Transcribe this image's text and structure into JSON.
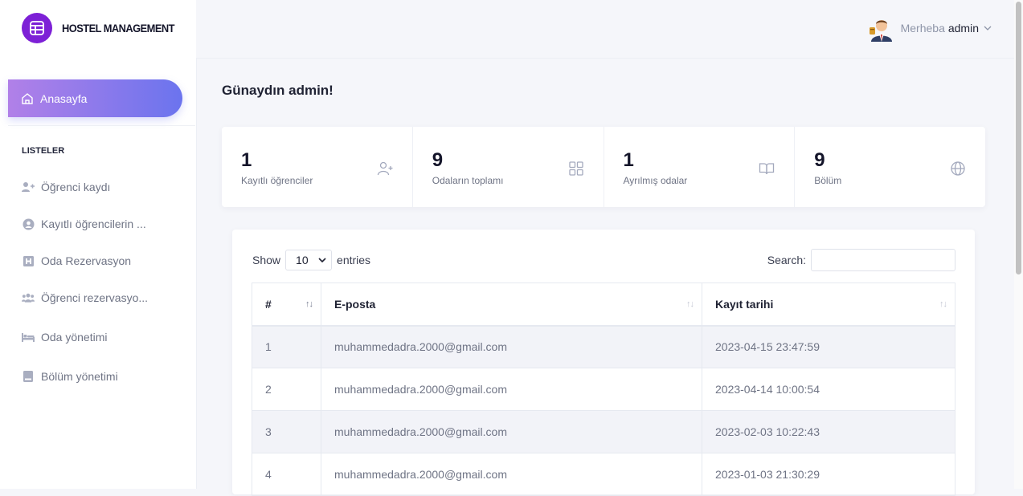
{
  "brand": {
    "name": "HOSTEL MANAGEMENT"
  },
  "sidebar": {
    "active": {
      "label": "Anasayfa",
      "icon": "home-icon"
    },
    "section_title": "LISTELER",
    "items": [
      {
        "label": "Öğrenci kaydı",
        "icon": "user-plus-icon"
      },
      {
        "label": "Kayıtlı öğrencilerin ...",
        "icon": "user-circle-icon"
      },
      {
        "label": "Oda Rezervasyon",
        "icon": "room-icon"
      },
      {
        "label": "Öğrenci rezervasyo...",
        "icon": "users-icon"
      },
      {
        "label": "Oda yönetimi",
        "icon": "bed-icon"
      },
      {
        "label": "Bölüm yönetimi",
        "icon": "book-icon"
      }
    ]
  },
  "header": {
    "greeting": "Merheba",
    "username": "admin"
  },
  "page": {
    "title": "Günaydın admin!"
  },
  "stats": [
    {
      "value": "1",
      "label": "Kayıtlı öğrenciler",
      "icon": "user-plus-icon"
    },
    {
      "value": "9",
      "label": "Odaların toplamı",
      "icon": "grid-icon"
    },
    {
      "value": "1",
      "label": "Ayrılmış odalar",
      "icon": "book-open-icon"
    },
    {
      "value": "9",
      "label": "Bölüm",
      "icon": "globe-icon"
    }
  ],
  "table": {
    "length_prefix": "Show",
    "length_value": "10",
    "length_suffix": "entries",
    "search_label": "Search:",
    "search_value": "",
    "columns": [
      "#",
      "E-posta",
      "Kayıt tarihi"
    ],
    "rows": [
      [
        "1",
        "muhammedadra.2000@gmail.com",
        "2023-04-15 23:47:59"
      ],
      [
        "2",
        "muhammedadra.2000@gmail.com",
        "2023-04-14 10:00:54"
      ],
      [
        "3",
        "muhammedadra.2000@gmail.com",
        "2023-02-03 10:22:43"
      ],
      [
        "4",
        "muhammedadra.2000@gmail.com",
        "2023-01-03 21:30:29"
      ]
    ]
  },
  "colors": {
    "accent_start": "#b180e8",
    "accent_end": "#6b74ee",
    "brand": "#7d20d6"
  }
}
